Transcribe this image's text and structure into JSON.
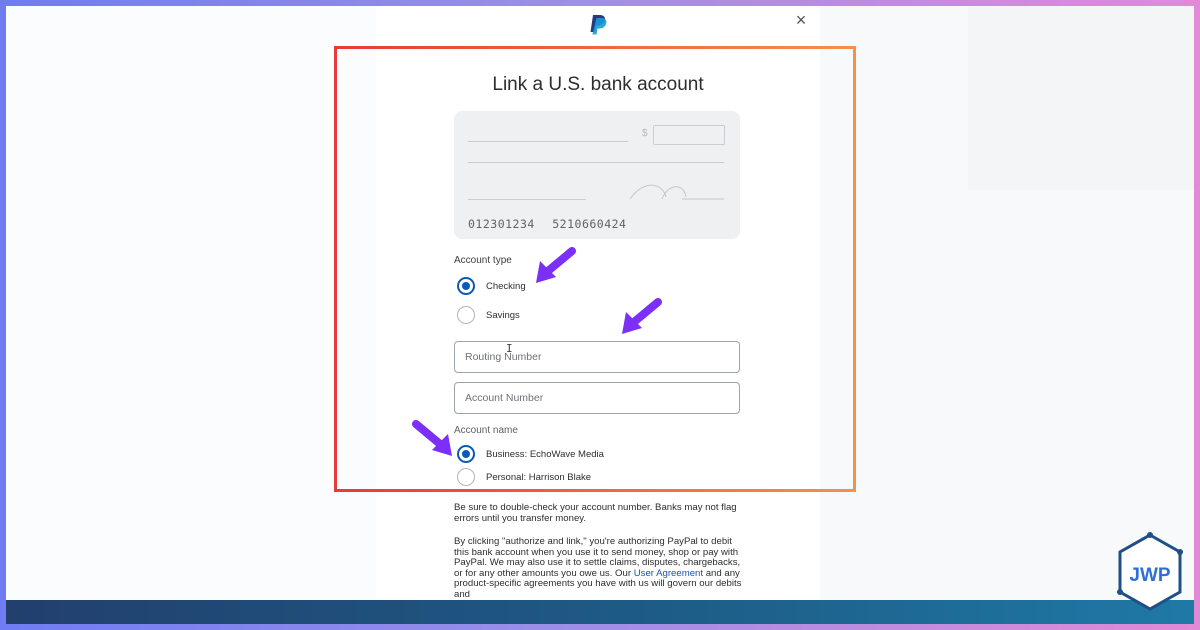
{
  "header": {
    "close_symbol": "×",
    "logo_icon": "paypal-logo",
    "close_icon": "close-x-icon"
  },
  "title": "Link a U.S. bank account",
  "check_preview": {
    "currency_symbol": "$",
    "routing_sample": "012301234",
    "account_sample": "5210660424"
  },
  "account_type": {
    "label": "Account type",
    "options": [
      {
        "label": "Checking",
        "selected": true
      },
      {
        "label": "Savings",
        "selected": false
      }
    ]
  },
  "fields": {
    "routing_placeholder": "Routing Number",
    "account_placeholder": "Account Number"
  },
  "account_name": {
    "label": "Account name",
    "options": [
      {
        "label": "Business: EchoWave Media",
        "selected": true
      },
      {
        "label": "Personal: Harrison Blake",
        "selected": false
      }
    ]
  },
  "disclaimer": {
    "line1": "Be sure to double-check your account number. Banks may not flag errors until you transfer money.",
    "line2_before": "By clicking \"authorize and link,\" you're authorizing PayPal to debit this bank account when you use it to send money, shop or pay with PayPal. We may also use it to settle claims, disputes, chargebacks, or for any other amounts you owe us. Our ",
    "line2_link": "User Agreement",
    "line2_after": " and any product-specific agreements you have with us will govern our debits and"
  },
  "colors": {
    "accent_blue": "#0a5bb8",
    "highlight_border": "#f3703c",
    "annotation_arrow": "#7b2ff7"
  },
  "annotations": {
    "arrow_icon": "annotation-arrow-icon"
  },
  "watermark": {
    "brand": "JWP"
  }
}
